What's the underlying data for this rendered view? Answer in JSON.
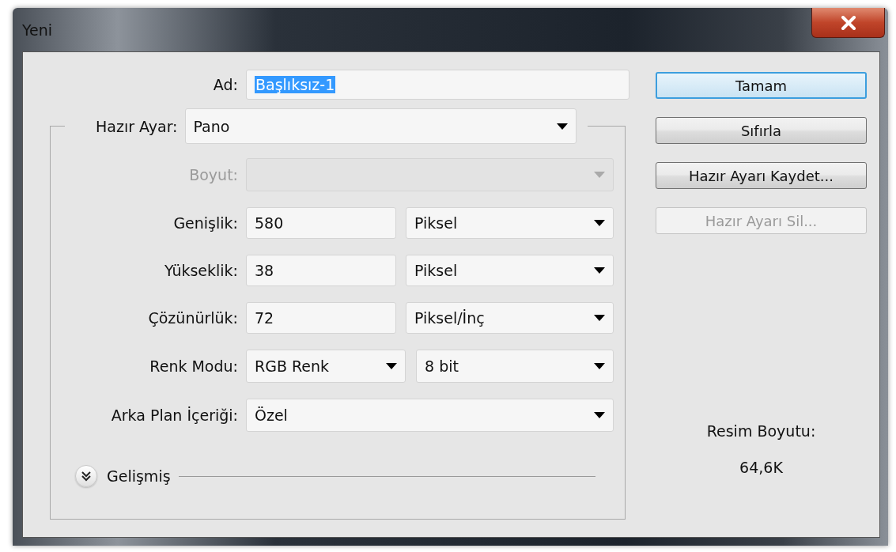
{
  "window": {
    "title": "Yeni"
  },
  "name_field": {
    "label": "Ad:",
    "value": "Başlıksız-1",
    "highlighted": true
  },
  "preset": {
    "label": "Hazır Ayar:",
    "value": "Pano"
  },
  "rows": [
    {
      "kind": "select",
      "label": "Boyut:",
      "disabled": true
    },
    {
      "kind": "value_unit",
      "label": "Genişlik:",
      "disabled": false,
      "controls": [
        {
          "value": "580"
        },
        {
          "value": "Piksel"
        }
      ]
    },
    {
      "kind": "value_unit",
      "label": "Yükseklik:",
      "disabled": false,
      "controls": [
        {
          "value": "38"
        },
        {
          "value": "Piksel"
        }
      ]
    },
    {
      "kind": "value_unit",
      "label": "Çözünürlük:",
      "disabled": false,
      "controls": [
        {
          "value": "72"
        },
        {
          "value": "Piksel/İnç"
        }
      ]
    },
    {
      "kind": "double_select",
      "label": "Renk Modu:",
      "disabled": false,
      "controls": [
        {
          "value": "RGB Renk"
        },
        {
          "value": "8 bit"
        }
      ]
    },
    {
      "kind": "select",
      "label": "Arka Plan İçeriği:",
      "disabled": false,
      "controls": [
        {
          "value": "Özel"
        }
      ]
    }
  ],
  "advanced": {
    "label": "Gelişmiş",
    "expanded": false
  },
  "buttons": [
    {
      "label": "Tamam",
      "kind": "default",
      "disabled": false
    },
    {
      "label": "Sıfırla",
      "kind": "normal",
      "disabled": false
    },
    {
      "label": "Hazır Ayarı Kaydet...",
      "kind": "normal",
      "disabled": false
    },
    {
      "label": "Hazır Ayarı Sil...",
      "kind": "normal",
      "disabled": true
    }
  ],
  "image_size": {
    "label": "Resim Boyutu:",
    "value": "64,6K"
  }
}
